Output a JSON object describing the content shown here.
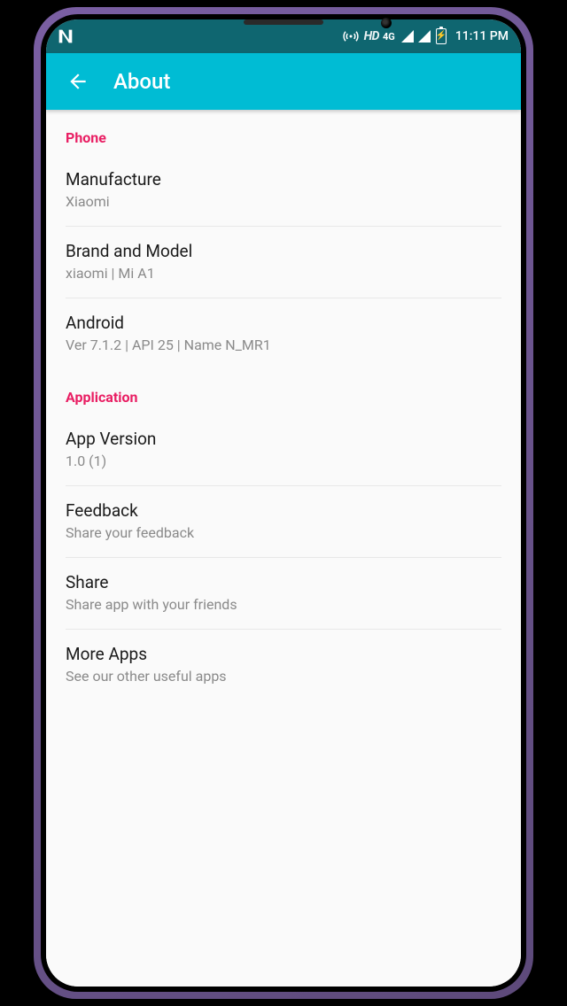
{
  "status": {
    "hd_label": "HD",
    "net_label": "4G",
    "time": "11:11 PM"
  },
  "header": {
    "title": "About"
  },
  "sections": {
    "phone": {
      "header": "Phone",
      "items": {
        "manufacture": {
          "title": "Manufacture",
          "sub": "Xiaomi"
        },
        "brand": {
          "title": "Brand and Model",
          "sub": "xiaomi | Mi A1"
        },
        "android": {
          "title": "Android",
          "sub": "Ver 7.1.2 | API 25 | Name N_MR1"
        }
      }
    },
    "app": {
      "header": "Application",
      "items": {
        "version": {
          "title": "App Version",
          "sub": "1.0 (1)"
        },
        "feedback": {
          "title": "Feedback",
          "sub": "Share your feedback"
        },
        "share": {
          "title": "Share",
          "sub": "Share app with your friends"
        },
        "more": {
          "title": "More Apps",
          "sub": "See our other useful apps"
        }
      }
    }
  }
}
